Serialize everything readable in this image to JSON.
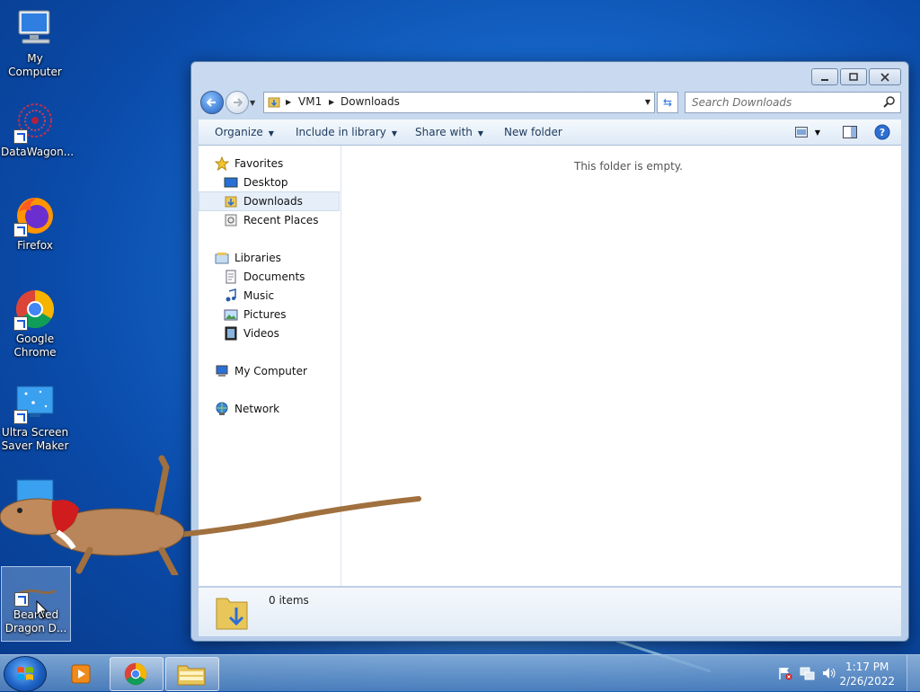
{
  "desktop": {
    "icons": [
      {
        "label": "My Computer"
      },
      {
        "label": "DataWagon..."
      },
      {
        "label": "Firefox"
      },
      {
        "label": "Google Chrome"
      },
      {
        "label": "Ultra Screen Saver Maker"
      },
      {
        "label": "Bearded Dragon D..."
      }
    ]
  },
  "explorer": {
    "address": {
      "crumbs": [
        "VM1",
        "Downloads"
      ]
    },
    "search": {
      "placeholder": "Search Downloads"
    },
    "toolbar": {
      "organize": "Organize",
      "include_in_library": "Include in library",
      "share_with": "Share with",
      "new_folder": "New folder"
    },
    "nav": {
      "favorites": "Favorites",
      "desktop": "Desktop",
      "downloads": "Downloads",
      "recent_places": "Recent Places",
      "libraries": "Libraries",
      "documents": "Documents",
      "music": "Music",
      "pictures": "Pictures",
      "videos": "Videos",
      "my_computer": "My Computer",
      "network": "Network"
    },
    "empty_message": "This folder is empty.",
    "details": {
      "count": "0 items"
    }
  },
  "taskbar": {
    "time": "1:17 PM",
    "date": "2/26/2022"
  },
  "colors": {
    "desktop_bg": "#1565c8",
    "accent": "#1d5fc2"
  }
}
